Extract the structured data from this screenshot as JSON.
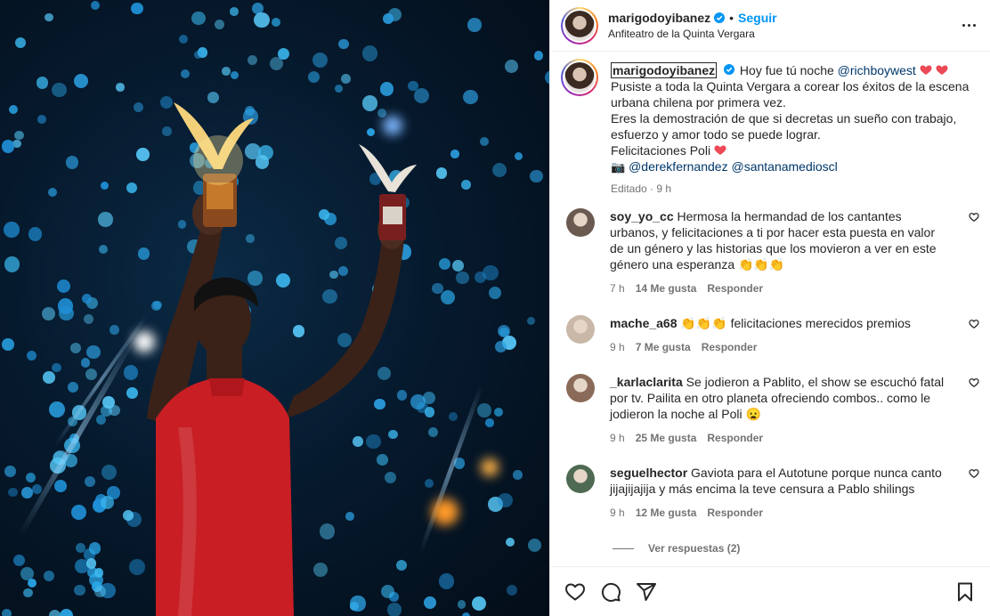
{
  "post": {
    "username": "marigodoyibanez",
    "separator": "•",
    "follow_label": "Seguir",
    "location": "Anfiteatro de la Quinta Vergara"
  },
  "caption": {
    "username": "marigodoyibanez",
    "line1_text": "Hoy fue tú noche ",
    "line1_mention": "@richboywest",
    "line2": "Pusiste a toda la Quinta Vergara a corear los éxitos de la escena urbana chilena por primera vez.",
    "line3": "Eres la demostración de que si decretas un sueño con trabajo, esfuerzo y amor todo se puede lograr.",
    "line4": "Felicitaciones Poli ",
    "camera_emoji": "📷",
    "credit_mention_1": "@derekfernandez",
    "credit_mention_2": "@santanamediosc",
    "credit_tail": "l",
    "edited_label": "Editado · 9 h"
  },
  "comments": [
    {
      "username": "soy_yo_cc",
      "text": "Hermosa la hermandad de los cantantes urbanos, y felicitaciones a ti por hacer esta puesta en valor de un género y las historias que los movieron a ver en este género una esperanza 👏👏👏",
      "time": "7 h",
      "likes": "14 Me gusta",
      "reply": "Responder",
      "avatar_color": "#6b5a50"
    },
    {
      "username": "mache_a68",
      "text": "👏👏👏 felicitaciones merecidos premios",
      "time": "9 h",
      "likes": "7 Me gusta",
      "reply": "Responder",
      "avatar_color": "#c9b8a8"
    },
    {
      "username": "_karlaclarita",
      "text": "Se jodieron a Pablito, el show se escuchó fatal por tv. Pailita en otro planeta ofreciendo combos.. como le jodieron la noche al Poli 😦",
      "time": "9 h",
      "likes": "25 Me gusta",
      "reply": "Responder",
      "avatar_color": "#8a6a58"
    },
    {
      "username": "seguelhector",
      "text": "Gaviota para el Autotune porque nunca canto jijajijajija y más encima la teve censura a Pablo shilings",
      "time": "9 h",
      "likes": "12 Me gusta",
      "reply": "Responder",
      "avatar_color": "#4e6a52"
    }
  ],
  "view_replies": "Ver respuestas (2)",
  "icons": {
    "verified": "verified-badge-icon",
    "more": "more-options-icon",
    "heart": "heart-icon",
    "comment": "comment-icon",
    "share": "share-icon",
    "save": "bookmark-icon"
  },
  "colors": {
    "accent": "#0095f6",
    "mention": "#00376b",
    "heart_red": "#ed4956",
    "muted": "#737373"
  }
}
